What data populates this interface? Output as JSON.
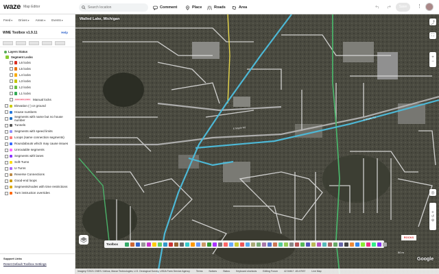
{
  "header": {
    "logo": "waze",
    "subtitle": "Map Editor",
    "search_placeholder": "Search location",
    "buttons": [
      "Comment",
      "Place",
      "Roads",
      "Area"
    ],
    "save_label": "Save",
    "more": "⋮"
  },
  "panel": {
    "tabs": [
      "Feed",
      "Drives",
      "Areas",
      "Events"
    ],
    "toolbox_title": "WME Toolbox v1.9.11",
    "help": "Help",
    "section_layers": "Layers Status",
    "segment_locks_title": "Segment Locks",
    "locks": [
      {
        "label": "L6 locks",
        "color": "#d93025"
      },
      {
        "label": "L5 locks",
        "color": "#e8710a"
      },
      {
        "label": "L4 locks",
        "color": "#f9ab00"
      },
      {
        "label": "L3 locks",
        "color": "#c5c500"
      },
      {
        "label": "L2 locks",
        "color": "#66bb44"
      },
      {
        "label": "L1 locks",
        "color": "#33aa55"
      }
    ],
    "manual_locks": "Manual locks",
    "manual_locks_badge": "Automatic prefer",
    "items": [
      {
        "label": "Elevation (-) or ground",
        "color": "#cccc00"
      },
      {
        "label": "House numbers",
        "color": "#2277dd"
      },
      {
        "label": "Segments with name but no house number",
        "color": "#1b6ec2"
      },
      {
        "label": "Tunnels",
        "color": "#555555"
      },
      {
        "label": "Segments with speed limits",
        "color": "#9090ff"
      },
      {
        "label": "Loops (same connection segments)",
        "color": "#ff7777"
      },
      {
        "label": "Roundabouts which may cause issues",
        "color": "#3366ff"
      },
      {
        "label": "Unroutable segments",
        "color": "#ff66ff"
      },
      {
        "label": "Segments with lanes",
        "color": "#8833ff"
      },
      {
        "label": "Soft-Turns",
        "color": "#ffdd00"
      },
      {
        "label": "U-Turns",
        "color": "#aa66ff"
      },
      {
        "label": "Reverse Connections",
        "color": "#b84"
      },
      {
        "label": "Good-end loops",
        "color": "#cc9900"
      },
      {
        "label": "Segments/nodes with time restrictions",
        "color": "#ddaa00"
      },
      {
        "label": "Turn instruction overrides",
        "color": "#ff6600"
      }
    ],
    "support_title": "Support Links",
    "support_link": "Reset Default Toolbox Settings"
  },
  "map": {
    "location": "Walled Lake, Michigan",
    "toolbar_label": "Toolbox",
    "scale": "50 m",
    "attribution": [
      "Imagery ©2021 CNES / Airbus, Maxar Technologies, U.S. Geological Survey, USDA Farm Service Agency",
      "Terms",
      "Notices",
      "Status",
      "Keyboard shortcuts",
      "Editing Forum",
      "42.54617 -83.47537",
      "Live Map"
    ],
    "google": "Google",
    "brand_badge": "ROCKS"
  }
}
